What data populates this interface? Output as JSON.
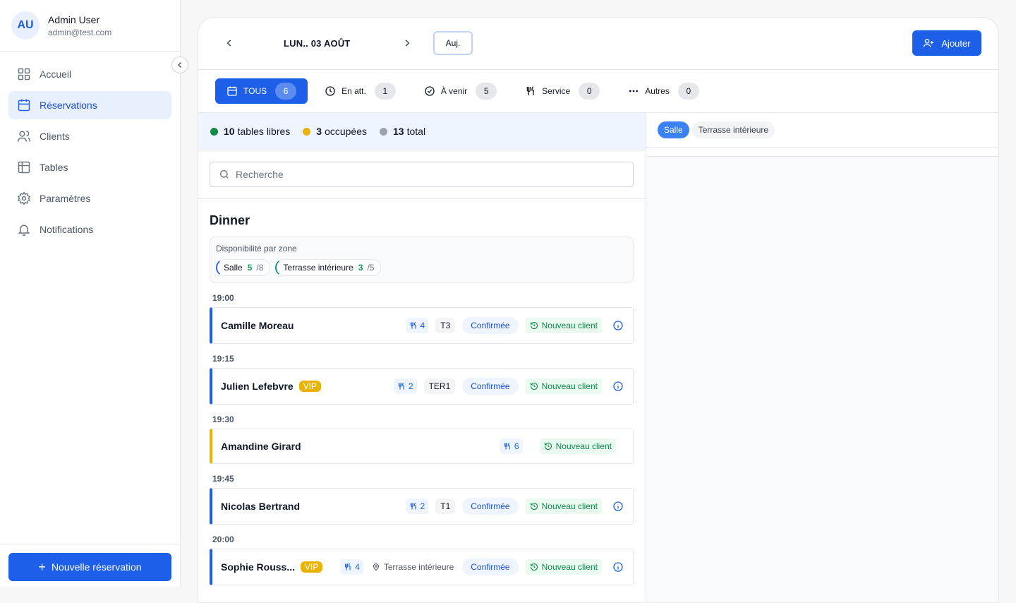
{
  "user": {
    "initials": "AU",
    "name": "Admin User",
    "email": "admin@test.com"
  },
  "nav": [
    {
      "label": "Accueil",
      "icon": "grid-icon",
      "active": false
    },
    {
      "label": "Réservations",
      "icon": "calendar-icon",
      "active": true
    },
    {
      "label": "Clients",
      "icon": "users-icon",
      "active": false
    },
    {
      "label": "Tables",
      "icon": "table-icon",
      "active": false
    },
    {
      "label": "Paramètres",
      "icon": "gear-icon",
      "active": false
    },
    {
      "label": "Notifications",
      "icon": "bell-icon",
      "active": false
    }
  ],
  "sidebar_footer": {
    "new_reservation_label": "Nouvelle réservation"
  },
  "header": {
    "date_label": "LUN.. 03 AOÛT",
    "today_label": "Auj.",
    "add_label": "Ajouter"
  },
  "filters": [
    {
      "label": "TOUS",
      "count": "6",
      "icon": "calendar-icon",
      "active": true
    },
    {
      "label": "En att.",
      "count": "1",
      "icon": "clock-icon",
      "active": false
    },
    {
      "label": "À venir",
      "count": "5",
      "icon": "check-circle-icon",
      "active": false
    },
    {
      "label": "Service",
      "count": "0",
      "icon": "utensils-icon",
      "active": false
    },
    {
      "label": "Autres",
      "count": "0",
      "icon": "more-icon",
      "active": false
    }
  ],
  "stats": {
    "free": {
      "value": "10",
      "label": "tables libres",
      "color": "#0f8a4c"
    },
    "occupied": {
      "value": "3",
      "label": "occupées",
      "color": "#eab308"
    },
    "total": {
      "value": "13",
      "label": "total",
      "color": "#9ca3af"
    }
  },
  "search": {
    "placeholder": "Recherche"
  },
  "service": {
    "title": "Dinner",
    "zone_label": "Disponibilité par zone",
    "zones": [
      {
        "name": "Salle",
        "free": "5",
        "total": "/8"
      },
      {
        "name": "Terrasse intérieure",
        "free": "3",
        "total": "/5"
      }
    ]
  },
  "reservations": [
    {
      "time": "19:00",
      "name": "Camille Moreau",
      "vip": "",
      "covers": "4",
      "table": "T3",
      "zone": "",
      "status": "Confirmée",
      "client_tag": "Nouveau client",
      "pending": false
    },
    {
      "time": "19:15",
      "name": "Julien Lefebvre",
      "vip": "VIP",
      "covers": "2",
      "table": "TER1",
      "zone": "",
      "status": "Confirmée",
      "client_tag": "Nouveau client",
      "pending": false
    },
    {
      "time": "19:30",
      "name": "Amandine Girard",
      "vip": "",
      "covers": "6",
      "table": "",
      "zone": "",
      "status": "",
      "client_tag": "Nouveau client",
      "pending": true
    },
    {
      "time": "19:45",
      "name": "Nicolas Bertrand",
      "vip": "",
      "covers": "2",
      "table": "T1",
      "zone": "",
      "status": "Confirmée",
      "client_tag": "Nouveau client",
      "pending": false
    },
    {
      "time": "20:00",
      "name": "Sophie Rouss...",
      "vip": "VIP",
      "covers": "4",
      "table": "",
      "zone": "Terrasse intérieure",
      "status": "Confirmée",
      "client_tag": "Nouveau client",
      "pending": false
    }
  ],
  "floor_tabs": [
    {
      "label": "Salle",
      "active": true
    },
    {
      "label": "Terrasse intérieure",
      "active": false
    }
  ],
  "colors": {
    "accent": "#1d5fe8",
    "pending": "#eab308",
    "success": "#0f8a4c"
  }
}
